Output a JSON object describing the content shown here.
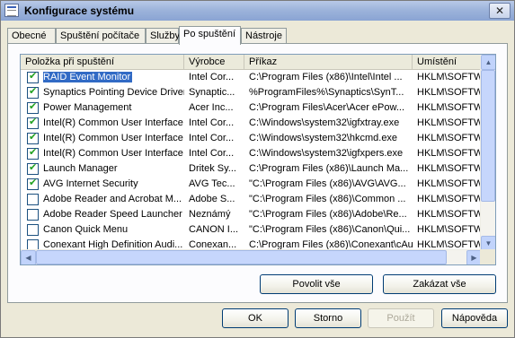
{
  "window": {
    "title": "Konfigurace systému",
    "close_glyph": "✕"
  },
  "tabs": [
    {
      "label": "Obecné"
    },
    {
      "label": "Spuštění počítače"
    },
    {
      "label": "Služby"
    },
    {
      "label": "Po spuštění"
    },
    {
      "label": "Nástroje"
    }
  ],
  "active_tab": "Po spuštění",
  "list": {
    "headers": [
      "Položka při spuštění",
      "Výrobce",
      "Příkaz",
      "Umístění"
    ],
    "rows": [
      {
        "checked": true,
        "name": "RAID Event Monitor",
        "vendor": "Intel Cor...",
        "command": "C:\\Program Files (x86)\\Intel\\Intel ...",
        "location": "HKLM\\SOFTWA",
        "selected": true
      },
      {
        "checked": true,
        "name": "Synaptics Pointing Device Driver",
        "vendor": "Synaptic...",
        "command": "%ProgramFiles%\\Synaptics\\SynT...",
        "location": "HKLM\\SOFTWA",
        "selected": false
      },
      {
        "checked": true,
        "name": "Power Management",
        "vendor": "Acer Inc...",
        "command": "C:\\Program Files\\Acer\\Acer ePow...",
        "location": "HKLM\\SOFTWA",
        "selected": false
      },
      {
        "checked": true,
        "name": "Intel(R) Common User Interface",
        "vendor": "Intel Cor...",
        "command": "C:\\Windows\\system32\\igfxtray.exe",
        "location": "HKLM\\SOFTWA",
        "selected": false
      },
      {
        "checked": true,
        "name": "Intel(R) Common User Interface",
        "vendor": "Intel Cor...",
        "command": "C:\\Windows\\system32\\hkcmd.exe",
        "location": "HKLM\\SOFTWA",
        "selected": false
      },
      {
        "checked": true,
        "name": "Intel(R) Common User Interface",
        "vendor": "Intel Cor...",
        "command": "C:\\Windows\\system32\\igfxpers.exe",
        "location": "HKLM\\SOFTWA",
        "selected": false
      },
      {
        "checked": true,
        "name": "Launch Manager",
        "vendor": "Dritek Sy...",
        "command": "C:\\Program Files (x86)\\Launch Ma...",
        "location": "HKLM\\SOFTWA",
        "selected": false
      },
      {
        "checked": true,
        "name": "AVG Internet Security",
        "vendor": "AVG Tec...",
        "command": "\"C:\\Program Files (x86)\\AVG\\AVG...",
        "location": "HKLM\\SOFTWA",
        "selected": false
      },
      {
        "checked": false,
        "name": "Adobe Reader and Acrobat M...",
        "vendor": "Adobe S...",
        "command": "\"C:\\Program Files (x86)\\Common ...",
        "location": "HKLM\\SOFTWA",
        "selected": false
      },
      {
        "checked": false,
        "name": "Adobe Reader Speed Launcher",
        "vendor": "Neznámý",
        "command": "\"C:\\Program Files (x86)\\Adobe\\Re...",
        "location": "HKLM\\SOFTWA",
        "selected": false
      },
      {
        "checked": false,
        "name": "Canon Quick Menu",
        "vendor": "CANON I...",
        "command": "\"C:\\Program Files (x86)\\Canon\\Qui...",
        "location": "HKLM\\SOFTWA",
        "selected": false
      },
      {
        "checked": false,
        "name": "Conexant High Definition Audi...",
        "vendor": "Conexan...",
        "command": "C:\\Program Files (x86)\\Conexant\\cAudi...",
        "location": "HKLM\\SOFTWA",
        "selected": false
      }
    ]
  },
  "buttons": {
    "enable_all": "Povolit vše",
    "disable_all": "Zakázat vše",
    "ok": "OK",
    "cancel": "Storno",
    "apply": "Použít",
    "help": "Nápověda"
  },
  "scroll_glyphs": {
    "up": "▲",
    "down": "▼",
    "left": "◀",
    "right": "▶"
  }
}
